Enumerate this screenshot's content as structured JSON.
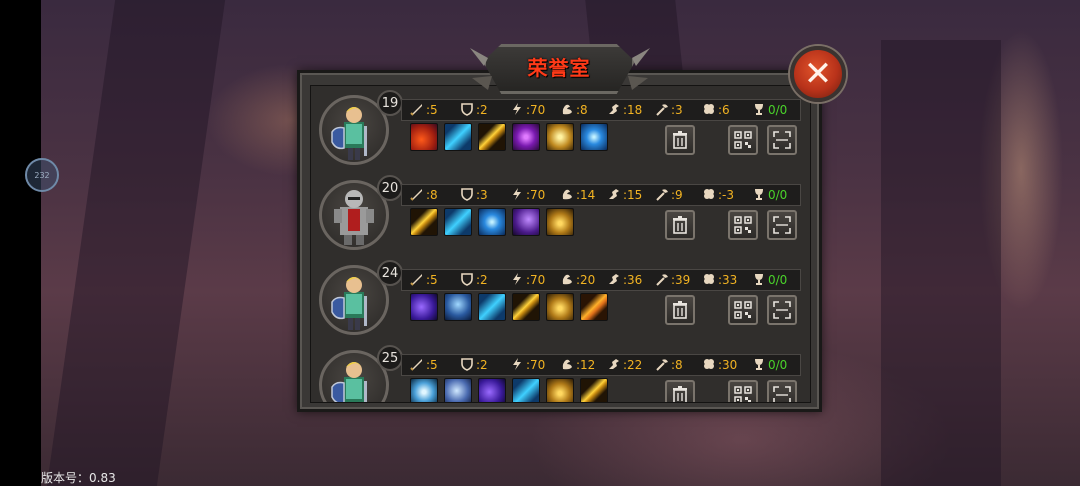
{
  "title": "荣誉室",
  "close_label": "✕",
  "version": "版本号：0.83",
  "side_bubble": "232",
  "rows": [
    {
      "level": "19",
      "hero": "blonde-knight",
      "atk": ":5",
      "def": ":2",
      "spd": ":70",
      "str": ":8",
      "agi": ":18",
      "crit": ":3",
      "luck": ":6",
      "trophy": "0/0",
      "skills": [
        "fire-slash",
        "water-wave",
        "lightning-streak",
        "purple-rune",
        "golden-shield",
        "blue-vortex"
      ]
    },
    {
      "level": "20",
      "hero": "armored-knight",
      "atk": ":8",
      "def": ":3",
      "spd": ":70",
      "str": ":14",
      "agi": ":15",
      "crit": ":9",
      "luck": ":-3",
      "trophy": "0/0",
      "skills": [
        "lightning-streak",
        "water-wave",
        "blue-vortex",
        "violet-beast",
        "gold-pot"
      ]
    },
    {
      "level": "24",
      "hero": "blonde-knight",
      "atk": ":5",
      "def": ":2",
      "spd": ":70",
      "str": ":20",
      "agi": ":36",
      "crit": ":39",
      "luck": ":33",
      "trophy": "0/0",
      "skills": [
        "purple-dragon",
        "blue-ghost",
        "water-wave",
        "lightning-streak",
        "gold-pot",
        "orange-streak"
      ]
    },
    {
      "level": "25",
      "hero": "blonde-knight",
      "atk": ":5",
      "def": ":2",
      "spd": ":70",
      "str": ":12",
      "agi": ":22",
      "crit": ":8",
      "luck": ":30",
      "trophy": "0/0",
      "skills": [
        "ice-wing",
        "frost-beast",
        "purple-dragon",
        "water-wave",
        "gold-pot",
        "lightning-streak"
      ]
    }
  ],
  "colors": {
    "stat_text": "#f2b322",
    "trophy_text": "#4ad32a",
    "title": "#ff3a18"
  }
}
